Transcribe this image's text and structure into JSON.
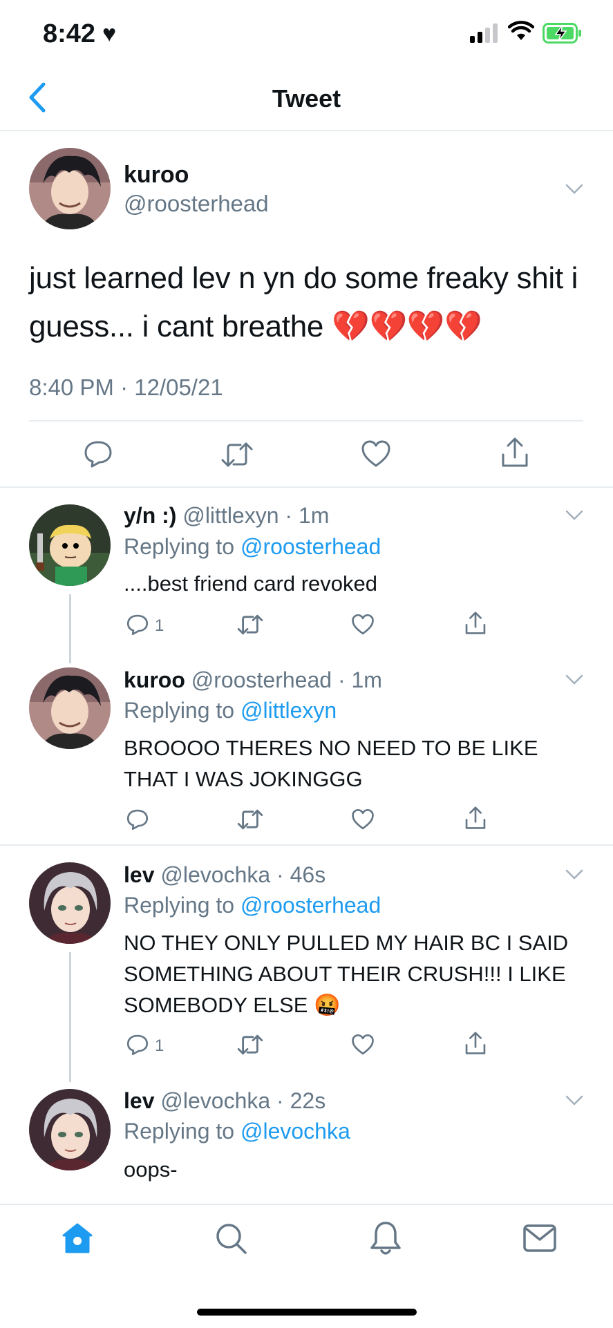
{
  "status_bar": {
    "time": "8:42",
    "heart_icon": "heart-icon",
    "battery_color": "#4cd964"
  },
  "nav": {
    "title": "Tweet",
    "accent": "#1d9bf0"
  },
  "main_tweet": {
    "name": "kuroo",
    "handle": "@roosterhead",
    "text": "just learned lev n yn do some freaky shit i guess... i cant breathe 💔💔💔💔",
    "meta": "8:40 PM · 12/05/21"
  },
  "replies": [
    {
      "name": "y/n :)",
      "handle_time": "@littlexyn · 1m",
      "replying_prefix": "Replying to",
      "replying_to": "@roosterhead",
      "text": "....best friend card revoked",
      "reply_count": "1"
    },
    {
      "name": "kuroo",
      "handle_time": "@roosterhead · 1m",
      "replying_prefix": "Replying to",
      "replying_to": "@littlexyn",
      "text": "BROOOO THERES NO NEED TO BE LIKE THAT I WAS JOKINGGG",
      "reply_count": ""
    },
    {
      "name": "lev",
      "handle_time": "@levochka · 46s",
      "replying_prefix": "Replying to",
      "replying_to": "@roosterhead",
      "text": "NO THEY ONLY PULLED MY HAIR BC I SAID SOMETHING ABOUT THEIR CRUSH!!! I LIKE SOMEBODY ELSE 🤬",
      "reply_count": "1"
    },
    {
      "name": "lev",
      "handle_time": "@levochka · 22s",
      "replying_prefix": "Replying to",
      "replying_to": "@levochka",
      "text": "oops-",
      "reply_count": ""
    }
  ],
  "tab_bar": [
    "home-icon",
    "search-icon",
    "notifications-icon",
    "messages-icon"
  ]
}
